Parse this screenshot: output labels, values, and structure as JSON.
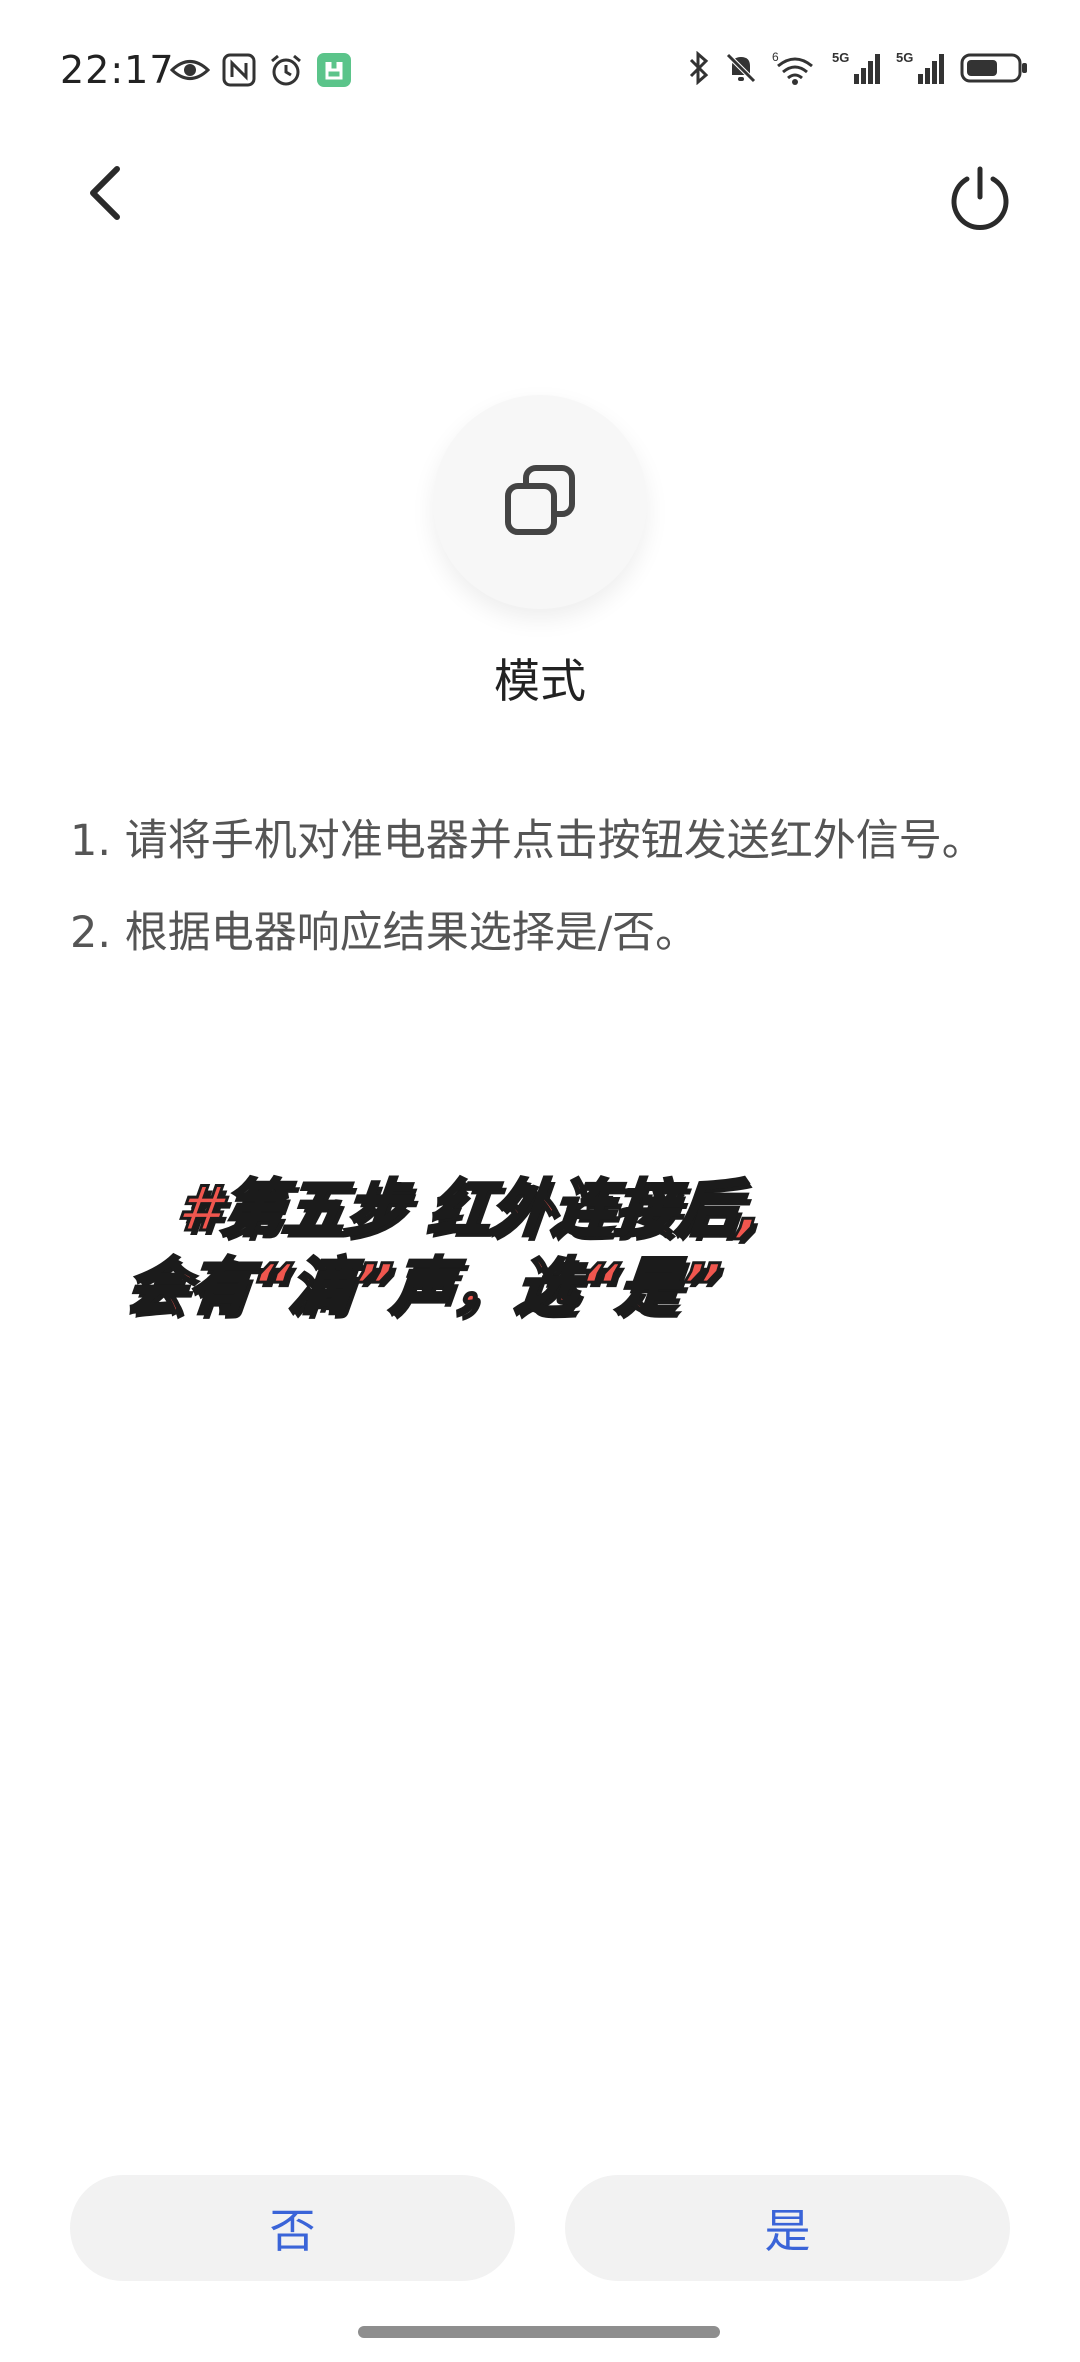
{
  "status_bar": {
    "time": "22:17",
    "left_icons": [
      "eye-icon",
      "nfc-icon",
      "alarm-icon",
      "mi-home-app-icon"
    ],
    "right_icons": [
      "bluetooth-icon",
      "mute-bell-icon",
      "wifi-icon",
      "signal-5g-icon",
      "signal-5g-icon",
      "battery-icon"
    ],
    "network_labels": [
      "5G",
      "5G"
    ],
    "wifi_label": "6"
  },
  "nav": {
    "back_icon": "chevron-left-icon",
    "power_icon": "power-icon"
  },
  "mode": {
    "icon": "copy-squares-icon",
    "label": "模式"
  },
  "instructions": {
    "line1": "1. 请将手机对准电器并点击按钮发送红外信号。",
    "line2": "2. 根据电器响应结果选择是/否。"
  },
  "overlay": {
    "line1": "#第五步  红外连接后,",
    "line2": "会有“滴”声，选“是”"
  },
  "buttons": {
    "no": "否",
    "yes": "是"
  },
  "colors": {
    "accent": "#3a64d8",
    "overlay_text": "#f0564e",
    "button_bg": "#f2f2f2"
  }
}
